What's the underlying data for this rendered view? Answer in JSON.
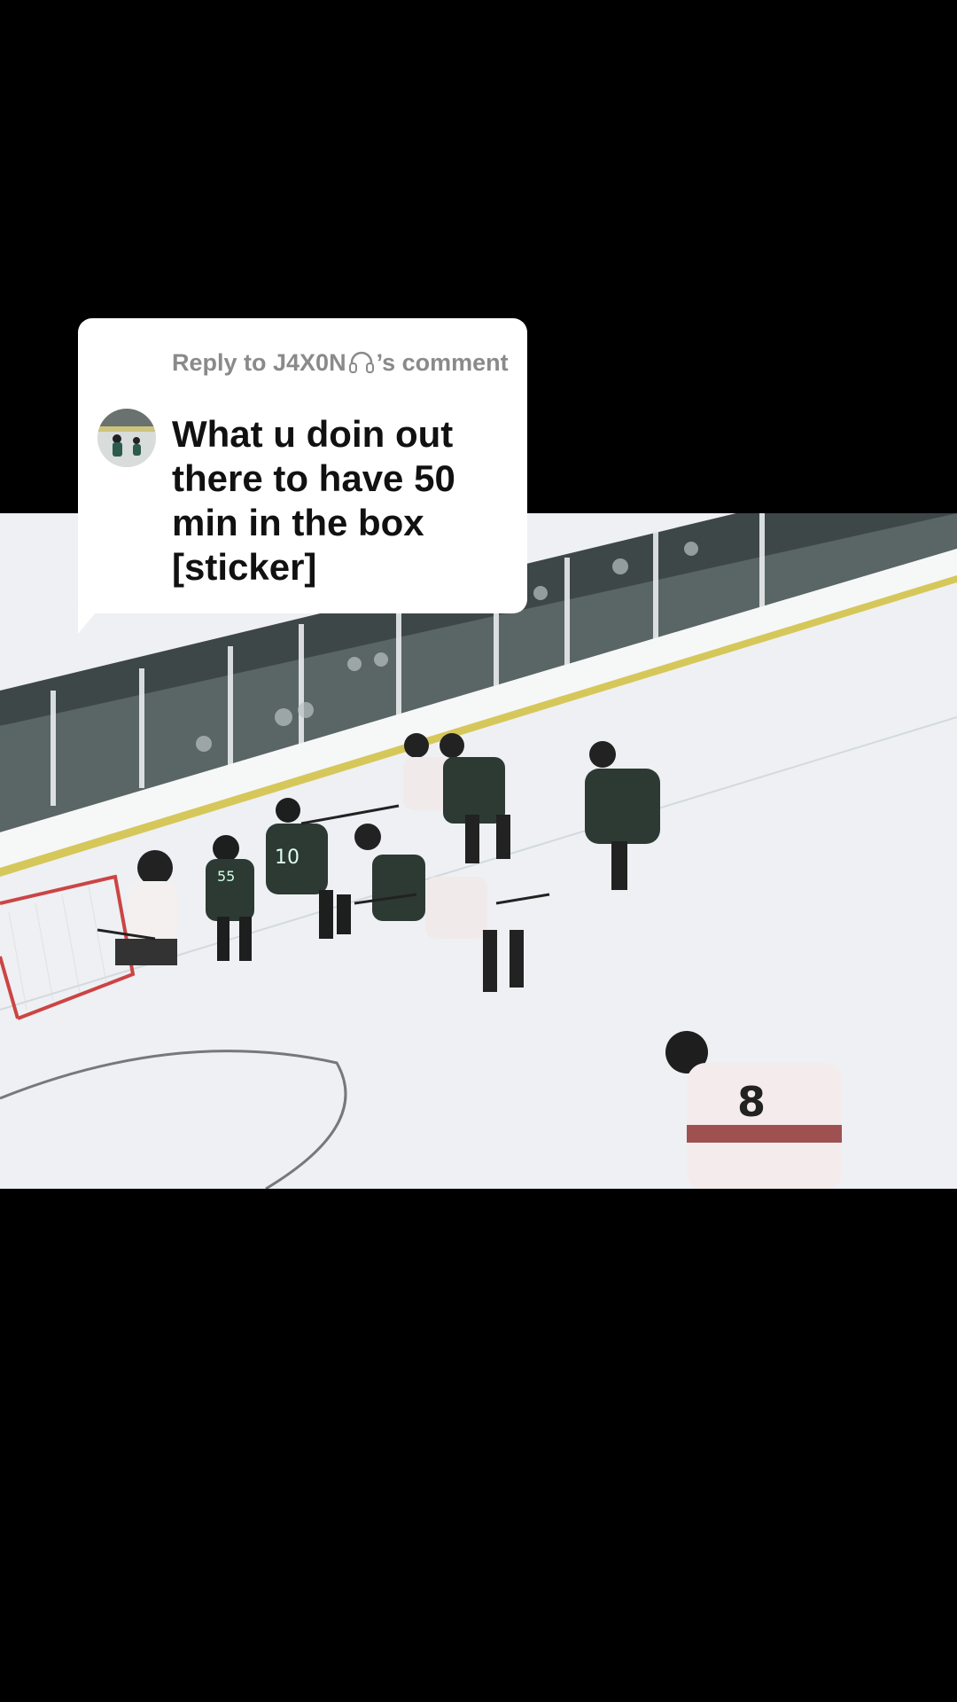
{
  "video": {
    "jersey_numbers": {
      "center_player": "10",
      "near_player": "8",
      "net_player": "55"
    }
  },
  "reply_card": {
    "header_prefix": "Reply to J4X0N",
    "header_suffix": "’s comment",
    "comment_text": "What u doin out there to have 50 min in the box [sticker]",
    "header_color": "#8a8a8a",
    "text_color": "#111111",
    "background_color": "#ffffff"
  },
  "icons": {
    "username_icon": "headphones-icon",
    "avatar": "avatar"
  }
}
